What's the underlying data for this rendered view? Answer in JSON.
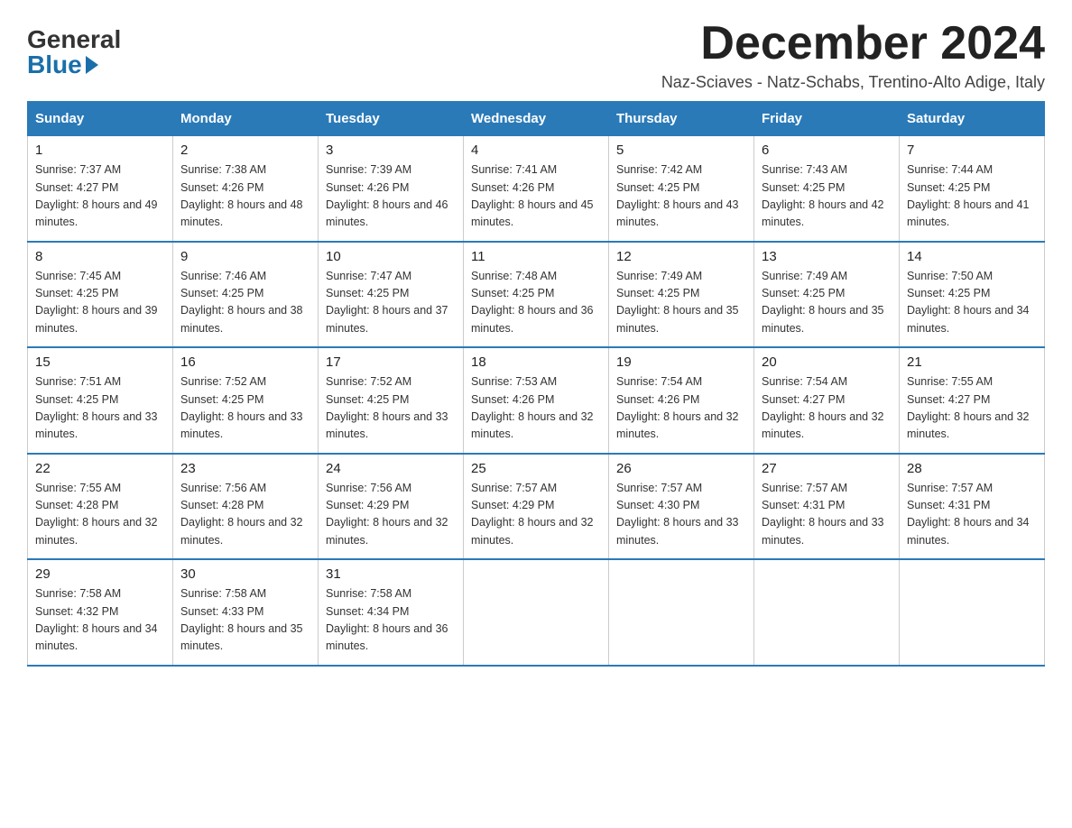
{
  "logo": {
    "general": "General",
    "blue": "Blue"
  },
  "header": {
    "month_title": "December 2024",
    "subtitle": "Naz-Sciaves - Natz-Schabs, Trentino-Alto Adige, Italy"
  },
  "weekdays": [
    "Sunday",
    "Monday",
    "Tuesday",
    "Wednesday",
    "Thursday",
    "Friday",
    "Saturday"
  ],
  "weeks": [
    [
      {
        "day": "1",
        "sunrise": "7:37 AM",
        "sunset": "4:27 PM",
        "daylight": "8 hours and 49 minutes."
      },
      {
        "day": "2",
        "sunrise": "7:38 AM",
        "sunset": "4:26 PM",
        "daylight": "8 hours and 48 minutes."
      },
      {
        "day": "3",
        "sunrise": "7:39 AM",
        "sunset": "4:26 PM",
        "daylight": "8 hours and 46 minutes."
      },
      {
        "day": "4",
        "sunrise": "7:41 AM",
        "sunset": "4:26 PM",
        "daylight": "8 hours and 45 minutes."
      },
      {
        "day": "5",
        "sunrise": "7:42 AM",
        "sunset": "4:25 PM",
        "daylight": "8 hours and 43 minutes."
      },
      {
        "day": "6",
        "sunrise": "7:43 AM",
        "sunset": "4:25 PM",
        "daylight": "8 hours and 42 minutes."
      },
      {
        "day": "7",
        "sunrise": "7:44 AM",
        "sunset": "4:25 PM",
        "daylight": "8 hours and 41 minutes."
      }
    ],
    [
      {
        "day": "8",
        "sunrise": "7:45 AM",
        "sunset": "4:25 PM",
        "daylight": "8 hours and 39 minutes."
      },
      {
        "day": "9",
        "sunrise": "7:46 AM",
        "sunset": "4:25 PM",
        "daylight": "8 hours and 38 minutes."
      },
      {
        "day": "10",
        "sunrise": "7:47 AM",
        "sunset": "4:25 PM",
        "daylight": "8 hours and 37 minutes."
      },
      {
        "day": "11",
        "sunrise": "7:48 AM",
        "sunset": "4:25 PM",
        "daylight": "8 hours and 36 minutes."
      },
      {
        "day": "12",
        "sunrise": "7:49 AM",
        "sunset": "4:25 PM",
        "daylight": "8 hours and 35 minutes."
      },
      {
        "day": "13",
        "sunrise": "7:49 AM",
        "sunset": "4:25 PM",
        "daylight": "8 hours and 35 minutes."
      },
      {
        "day": "14",
        "sunrise": "7:50 AM",
        "sunset": "4:25 PM",
        "daylight": "8 hours and 34 minutes."
      }
    ],
    [
      {
        "day": "15",
        "sunrise": "7:51 AM",
        "sunset": "4:25 PM",
        "daylight": "8 hours and 33 minutes."
      },
      {
        "day": "16",
        "sunrise": "7:52 AM",
        "sunset": "4:25 PM",
        "daylight": "8 hours and 33 minutes."
      },
      {
        "day": "17",
        "sunrise": "7:52 AM",
        "sunset": "4:25 PM",
        "daylight": "8 hours and 33 minutes."
      },
      {
        "day": "18",
        "sunrise": "7:53 AM",
        "sunset": "4:26 PM",
        "daylight": "8 hours and 32 minutes."
      },
      {
        "day": "19",
        "sunrise": "7:54 AM",
        "sunset": "4:26 PM",
        "daylight": "8 hours and 32 minutes."
      },
      {
        "day": "20",
        "sunrise": "7:54 AM",
        "sunset": "4:27 PM",
        "daylight": "8 hours and 32 minutes."
      },
      {
        "day": "21",
        "sunrise": "7:55 AM",
        "sunset": "4:27 PM",
        "daylight": "8 hours and 32 minutes."
      }
    ],
    [
      {
        "day": "22",
        "sunrise": "7:55 AM",
        "sunset": "4:28 PM",
        "daylight": "8 hours and 32 minutes."
      },
      {
        "day": "23",
        "sunrise": "7:56 AM",
        "sunset": "4:28 PM",
        "daylight": "8 hours and 32 minutes."
      },
      {
        "day": "24",
        "sunrise": "7:56 AM",
        "sunset": "4:29 PM",
        "daylight": "8 hours and 32 minutes."
      },
      {
        "day": "25",
        "sunrise": "7:57 AM",
        "sunset": "4:29 PM",
        "daylight": "8 hours and 32 minutes."
      },
      {
        "day": "26",
        "sunrise": "7:57 AM",
        "sunset": "4:30 PM",
        "daylight": "8 hours and 33 minutes."
      },
      {
        "day": "27",
        "sunrise": "7:57 AM",
        "sunset": "4:31 PM",
        "daylight": "8 hours and 33 minutes."
      },
      {
        "day": "28",
        "sunrise": "7:57 AM",
        "sunset": "4:31 PM",
        "daylight": "8 hours and 34 minutes."
      }
    ],
    [
      {
        "day": "29",
        "sunrise": "7:58 AM",
        "sunset": "4:32 PM",
        "daylight": "8 hours and 34 minutes."
      },
      {
        "day": "30",
        "sunrise": "7:58 AM",
        "sunset": "4:33 PM",
        "daylight": "8 hours and 35 minutes."
      },
      {
        "day": "31",
        "sunrise": "7:58 AM",
        "sunset": "4:34 PM",
        "daylight": "8 hours and 36 minutes."
      },
      null,
      null,
      null,
      null
    ]
  ]
}
